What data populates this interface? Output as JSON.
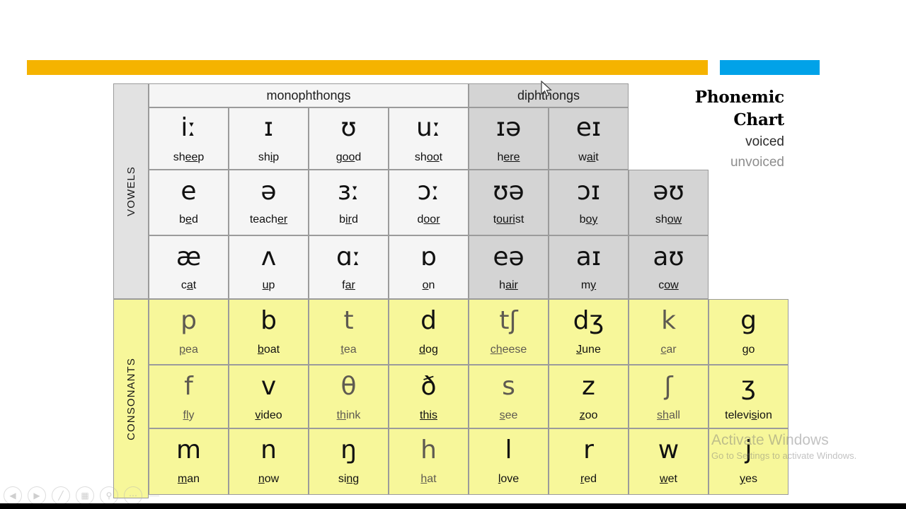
{
  "title": {
    "line1": "Phonemic",
    "line2": "Chart",
    "legend_voiced": "voiced",
    "legend_unvoiced": "unvoiced"
  },
  "bars": {
    "orange_color": "#f5b300",
    "blue_color": "#01a2e8"
  },
  "sections": {
    "vowels_label": "VOWELS",
    "consonants_label": "CONSONANTS"
  },
  "headers": {
    "monophthongs": "monophthongs",
    "diphthongs": "diphthongs"
  },
  "watermark": {
    "line1": "Activate Windows",
    "line2": "Go to Settings to activate Windows."
  },
  "chart_data": {
    "type": "table",
    "title": "Phonemic Chart",
    "columns": 8,
    "vowels": {
      "label": "VOWELS",
      "groups": [
        {
          "name": "monophthongs",
          "columns": [
            1,
            2,
            3,
            4
          ]
        },
        {
          "name": "diphthongs",
          "columns": [
            5,
            6,
            7
          ]
        }
      ],
      "rows": [
        [
          {
            "symbol": "iː",
            "word": "sheep",
            "underline": "ee",
            "group": "monophthong"
          },
          {
            "symbol": "ɪ",
            "word": "ship",
            "underline": "i",
            "group": "monophthong"
          },
          {
            "symbol": "ʊ",
            "word": "good",
            "underline": "oo",
            "group": "monophthong"
          },
          {
            "symbol": "uː",
            "word": "shoot",
            "underline": "oo",
            "group": "monophthong"
          },
          {
            "symbol": "ɪə",
            "word": "here",
            "underline": "ere",
            "group": "diphthong"
          },
          {
            "symbol": "eɪ",
            "word": "wait",
            "underline": "ai",
            "group": "diphthong"
          }
        ],
        [
          {
            "symbol": "e",
            "word": "bed",
            "underline": "e",
            "group": "monophthong"
          },
          {
            "symbol": "ə",
            "word": "teacher",
            "underline": "er",
            "group": "monophthong"
          },
          {
            "symbol": "ɜː",
            "word": "bird",
            "underline": "ir",
            "group": "monophthong"
          },
          {
            "symbol": "ɔː",
            "word": "door",
            "underline": "oor",
            "group": "monophthong"
          },
          {
            "symbol": "ʊə",
            "word": "tourist",
            "underline": "ouri",
            "group": "diphthong"
          },
          {
            "symbol": "ɔɪ",
            "word": "boy",
            "underline": "oy",
            "group": "diphthong"
          },
          {
            "symbol": "əʊ",
            "word": "show",
            "underline": "ow",
            "group": "diphthong"
          }
        ],
        [
          {
            "symbol": "æ",
            "word": "cat",
            "underline": "a",
            "group": "monophthong"
          },
          {
            "symbol": "ʌ",
            "word": "up",
            "underline": "u",
            "group": "monophthong"
          },
          {
            "symbol": "ɑː",
            "word": "far",
            "underline": "ar",
            "group": "monophthong"
          },
          {
            "symbol": "ɒ",
            "word": "on",
            "underline": "o",
            "group": "monophthong"
          },
          {
            "symbol": "eə",
            "word": "hair",
            "underline": "air",
            "group": "diphthong"
          },
          {
            "symbol": "aɪ",
            "word": "my",
            "underline": "y",
            "group": "diphthong"
          },
          {
            "symbol": "aʊ",
            "word": "cow",
            "underline": "ow",
            "group": "diphthong"
          }
        ]
      ]
    },
    "consonants": {
      "label": "CONSONANTS",
      "rows": [
        [
          {
            "symbol": "p",
            "word": "pea",
            "underline": "p",
            "voicing": "unvoiced"
          },
          {
            "symbol": "b",
            "word": "boat",
            "underline": "b",
            "voicing": "voiced"
          },
          {
            "symbol": "t",
            "word": "tea",
            "underline": "t",
            "voicing": "unvoiced"
          },
          {
            "symbol": "d",
            "word": "dog",
            "underline": "d",
            "voicing": "voiced"
          },
          {
            "symbol": "tʃ",
            "word": "cheese",
            "underline": "ch",
            "voicing": "unvoiced"
          },
          {
            "symbol": "dʒ",
            "word": "June",
            "underline": "J",
            "voicing": "voiced"
          },
          {
            "symbol": "k",
            "word": "car",
            "underline": "c",
            "voicing": "unvoiced"
          },
          {
            "symbol": "g",
            "word": "go",
            "underline": "g",
            "voicing": "voiced"
          }
        ],
        [
          {
            "symbol": "f",
            "word": "fly",
            "underline": "fl",
            "voicing": "unvoiced"
          },
          {
            "symbol": "v",
            "word": "video",
            "underline": "v",
            "voicing": "voiced"
          },
          {
            "symbol": "θ",
            "word": "think",
            "underline": "th",
            "voicing": "unvoiced"
          },
          {
            "symbol": "ð",
            "word": "this",
            "underline": "this",
            "voicing": "voiced"
          },
          {
            "symbol": "s",
            "word": "see",
            "underline": "s",
            "voicing": "unvoiced"
          },
          {
            "symbol": "z",
            "word": "zoo",
            "underline": "z",
            "voicing": "voiced"
          },
          {
            "symbol": "ʃ",
            "word": "shall",
            "underline": "sh",
            "voicing": "unvoiced"
          },
          {
            "symbol": "ʒ",
            "word": "television",
            "underline": "s",
            "voicing": "voiced"
          }
        ],
        [
          {
            "symbol": "m",
            "word": "man",
            "underline": "m",
            "voicing": "voiced"
          },
          {
            "symbol": "n",
            "word": "now",
            "underline": "n",
            "voicing": "voiced"
          },
          {
            "symbol": "ŋ",
            "word": "sing",
            "underline": "ng",
            "voicing": "voiced"
          },
          {
            "symbol": "h",
            "word": "hat",
            "underline": "h",
            "voicing": "unvoiced"
          },
          {
            "symbol": "l",
            "word": "love",
            "underline": "l",
            "voicing": "voiced"
          },
          {
            "symbol": "r",
            "word": "red",
            "underline": "r",
            "voicing": "voiced"
          },
          {
            "symbol": "w",
            "word": "wet",
            "underline": "w",
            "voicing": "voiced"
          },
          {
            "symbol": "j",
            "word": "yes",
            "underline": "y",
            "voicing": "voiced"
          }
        ]
      ]
    }
  },
  "toolbar": {
    "previous": "previous-slide",
    "next": "next-slide",
    "pen": "pen-tool",
    "slides": "slide-overview",
    "zoom": "magnifier",
    "more": "more-options"
  }
}
